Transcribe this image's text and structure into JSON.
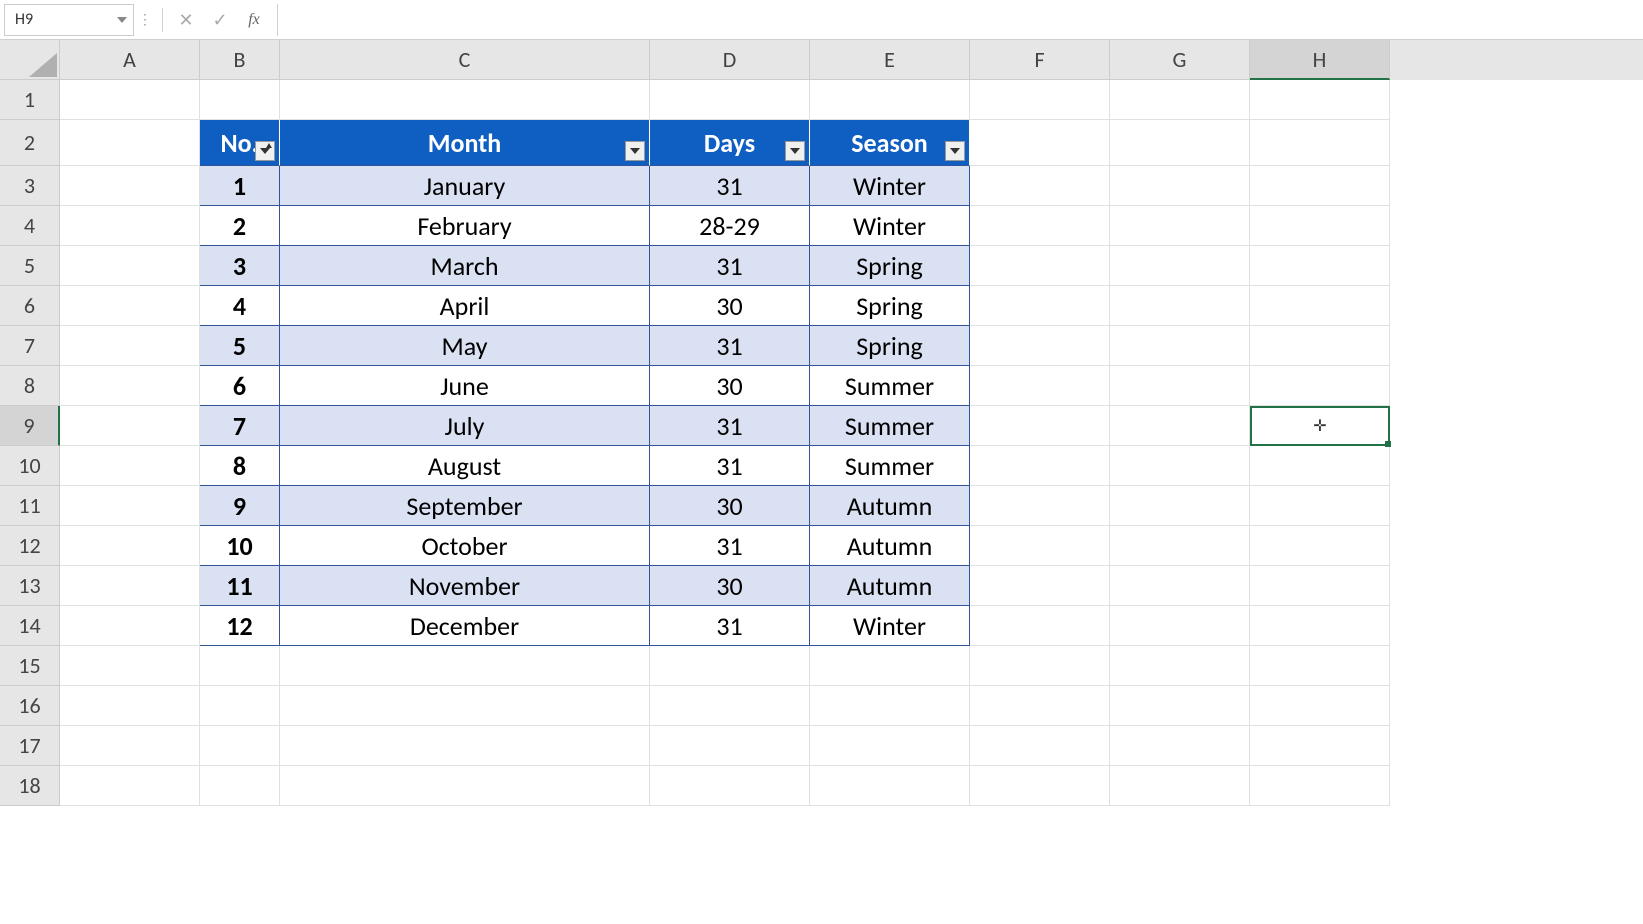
{
  "formula_bar": {
    "name_box": "H9",
    "cancel": "✕",
    "enter": "✓",
    "fx": "fx",
    "formula": ""
  },
  "columns": [
    "A",
    "B",
    "C",
    "D",
    "E",
    "F",
    "G",
    "H"
  ],
  "rows": [
    "1",
    "2",
    "3",
    "4",
    "5",
    "6",
    "7",
    "8",
    "9",
    "10",
    "11",
    "12",
    "13",
    "14",
    "15",
    "16",
    "17",
    "18"
  ],
  "selected_cell": "H9",
  "table": {
    "headers": [
      "No.",
      "Month",
      "Days",
      "Season"
    ],
    "rows": [
      {
        "no": "1",
        "month": "January",
        "days": "31",
        "season": "Winter"
      },
      {
        "no": "2",
        "month": "February",
        "days": "28-29",
        "season": "Winter"
      },
      {
        "no": "3",
        "month": "March",
        "days": "31",
        "season": "Spring"
      },
      {
        "no": "4",
        "month": "April",
        "days": "30",
        "season": "Spring"
      },
      {
        "no": "5",
        "month": "May",
        "days": "31",
        "season": "Spring"
      },
      {
        "no": "6",
        "month": "June",
        "days": "30",
        "season": "Summer"
      },
      {
        "no": "7",
        "month": "July",
        "days": "31",
        "season": "Summer"
      },
      {
        "no": "8",
        "month": "August",
        "days": "31",
        "season": "Summer"
      },
      {
        "no": "9",
        "month": "September",
        "days": "30",
        "season": "Autumn"
      },
      {
        "no": "10",
        "month": "October",
        "days": "31",
        "season": "Autumn"
      },
      {
        "no": "11",
        "month": "November",
        "days": "30",
        "season": "Autumn"
      },
      {
        "no": "12",
        "month": "December",
        "days": "31",
        "season": "Winter"
      }
    ]
  }
}
